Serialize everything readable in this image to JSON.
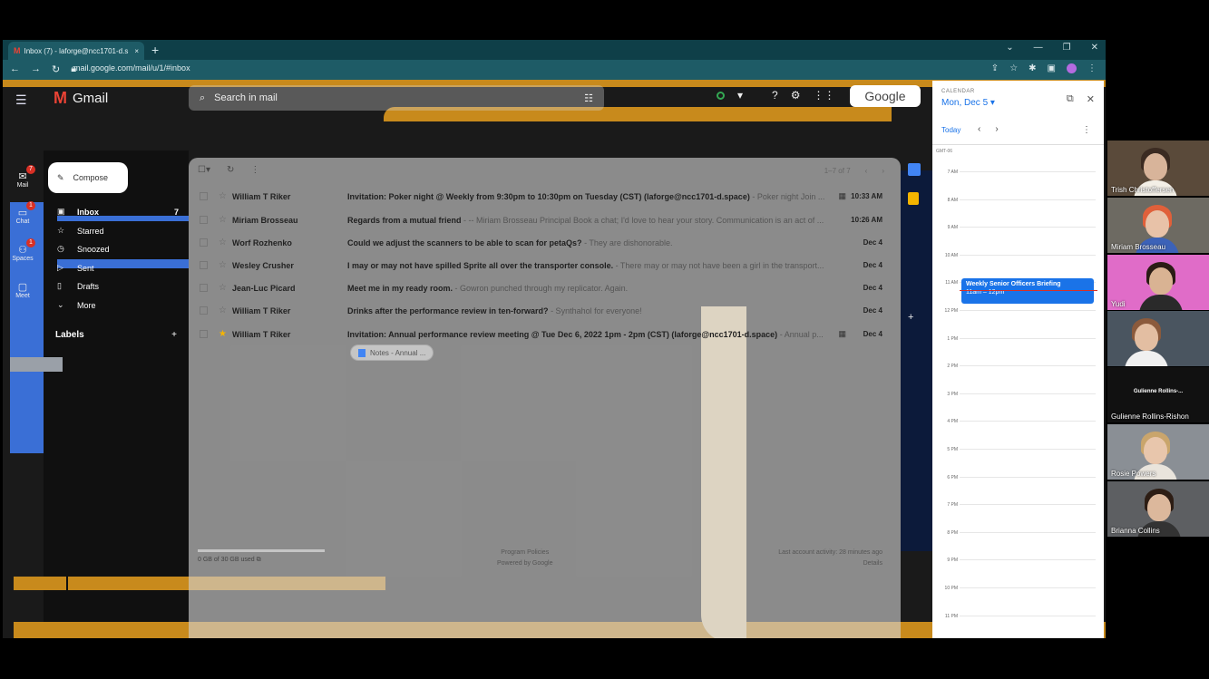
{
  "browser": {
    "tab_title": "Inbox (7) - laforge@ncc1701-d.s",
    "tab_close": "×",
    "new_tab": "+",
    "url": "mail.google.com/mail/u/1/#inbox"
  },
  "gmail": {
    "logo_text": "Gmail",
    "search_placeholder": "Search in mail",
    "google_badge": "Google",
    "compose": "Compose",
    "rail": [
      {
        "label": "Mail",
        "badge": "7"
      },
      {
        "label": "Chat",
        "badge": "1"
      },
      {
        "label": "Spaces",
        "badge": "1"
      },
      {
        "label": "Meet",
        "badge": ""
      }
    ],
    "nav": [
      {
        "label": "Inbox",
        "count": "7"
      },
      {
        "label": "Starred",
        "count": ""
      },
      {
        "label": "Snoozed",
        "count": ""
      },
      {
        "label": "Sent",
        "count": ""
      },
      {
        "label": "Drafts",
        "count": ""
      },
      {
        "label": "More",
        "count": ""
      }
    ],
    "labels_heading": "Labels",
    "labels_add": "+",
    "pager": "1–7 of 7",
    "emails": [
      {
        "sender": "William T Riker",
        "subject": "Invitation: Poker night @ Weekly from 9:30pm to 10:30pm on Tuesday (CST) (laforge@ncc1701-d.space)",
        "snippet": " - Poker night Join ...",
        "time": "10:33 AM",
        "starred": false,
        "calendar": true
      },
      {
        "sender": "Miriam Brosseau",
        "subject": "Regards from a mutual friend",
        "snippet": " - -- Miriam Brosseau Principal Book a chat; I'd love to hear your story. Communication is an act of ...",
        "time": "10:26 AM",
        "starred": false,
        "calendar": false
      },
      {
        "sender": "Worf Rozhenko",
        "subject": "Could we adjust the scanners to be able to scan for petaQs?",
        "snippet": " - They are dishonorable.",
        "time": "Dec 4",
        "starred": false,
        "calendar": false
      },
      {
        "sender": "Wesley Crusher",
        "subject": "I may or may not have spilled Sprite all over the transporter console.",
        "snippet": " - There may or may not have been a girl in the transport...",
        "time": "Dec 4",
        "starred": false,
        "calendar": false
      },
      {
        "sender": "Jean-Luc Picard",
        "subject": "Meet me in my ready room.",
        "snippet": " - Gowron punched through my replicator. Again.",
        "time": "Dec 4",
        "starred": false,
        "calendar": false
      },
      {
        "sender": "William T Riker",
        "subject": "Drinks after the performance review in ten-forward?",
        "snippet": " - Synthahol for everyone!",
        "time": "Dec 4",
        "starred": false,
        "calendar": false
      },
      {
        "sender": "William T Riker",
        "subject": "Invitation: Annual performance review meeting @ Tue Dec 6, 2022 1pm - 2pm (CST) (laforge@ncc1701-d.space)",
        "snippet": " - Annual p...",
        "time": "Dec 4",
        "starred": true,
        "calendar": true
      }
    ],
    "attachment_chip": "Notes - Annual ...",
    "storage": "0 GB of 30 GB used",
    "footer_policies": "Program Policies",
    "footer_powered": "Powered by Google",
    "footer_activity": "Last account activity: 28 minutes ago",
    "footer_details": "Details"
  },
  "calendar": {
    "label": "CALENDAR",
    "date": "Mon, Dec 5 ▾",
    "today": "Today",
    "timezone": "GMT-06",
    "hours": [
      "7 AM",
      "8 AM",
      "9 AM",
      "10 AM",
      "11 AM",
      "12 PM",
      "1 PM",
      "2 PM",
      "3 PM",
      "4 PM",
      "5 PM",
      "6 PM",
      "7 PM",
      "8 PM",
      "9 PM",
      "10 PM",
      "11 PM"
    ],
    "event_title": "Weekly Senior Officers Briefing",
    "event_time": "11am – 12pm"
  },
  "participants": [
    {
      "name": "Trish Christoffersen"
    },
    {
      "name": "Miriam Brosseau"
    },
    {
      "name": "Yudi"
    },
    {
      "name": ""
    },
    {
      "name": "Gulienne Rollins-Rishon",
      "center": "Gulienne Rollins-..."
    },
    {
      "name": "Rosie Powers"
    },
    {
      "name": "Brianna Collins"
    }
  ]
}
